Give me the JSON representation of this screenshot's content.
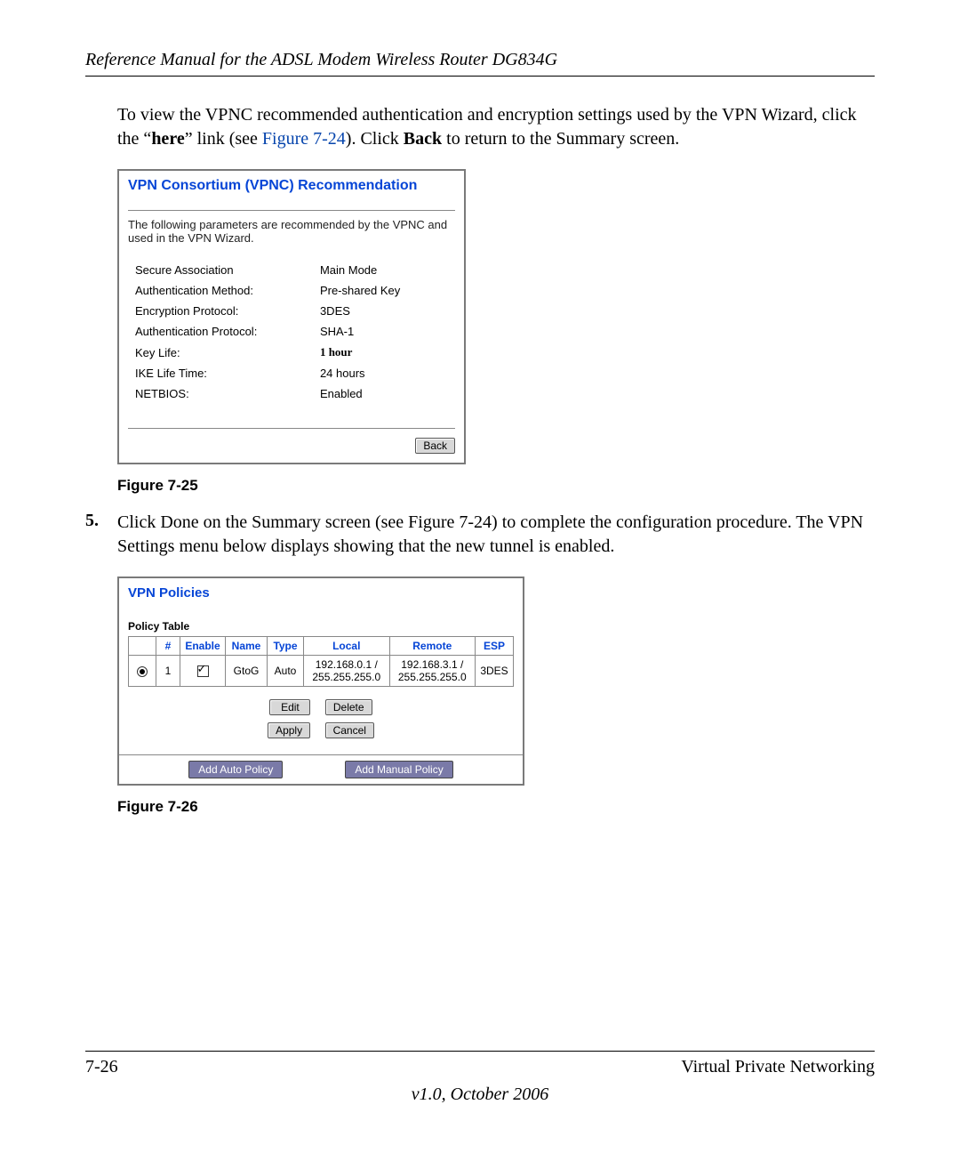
{
  "header": {
    "title": "Reference Manual for the ADSL Modem Wireless Router DG834G"
  },
  "intro": {
    "pre": "To view the VPNC recommended authentication and encryption settings used by the VPN Wizard, click the “",
    "here": "here",
    "mid": "” link (see ",
    "figref": "Figure 7-24",
    "post1": "). Click ",
    "back": "Back",
    "post2": " to return to the Summary screen."
  },
  "fig25": {
    "caption": "Figure 7-25",
    "title": "VPN Consortium (VPNC) Recommendation",
    "lead": "The following parameters are recommended by the VPNC and used in the VPN Wizard.",
    "rows": [
      {
        "label": "Secure Association",
        "value": "Main Mode"
      },
      {
        "label": "Authentication Method:",
        "value": "Pre-shared Key"
      },
      {
        "label": "Encryption Protocol:",
        "value": "3DES"
      },
      {
        "label": "Authentication Protocol:",
        "value": "SHA-1"
      },
      {
        "label": "Key Life:",
        "value": "1 hour",
        "bold": true
      },
      {
        "label": "IKE Life Time:",
        "value": "24 hours"
      },
      {
        "label": "NETBIOS:",
        "value": "Enabled"
      }
    ],
    "back_btn": "Back"
  },
  "step5": {
    "num": "5.",
    "pre": "Click ",
    "done": "Done",
    "mid": " on the Summary screen (see ",
    "figref": "Figure 7-24",
    "post": ") to complete the configuration procedure. The VPN Settings menu below displays showing that the new tunnel is enabled."
  },
  "fig26": {
    "caption": "Figure 7-26",
    "title": "VPN Policies",
    "subhead": "Policy Table",
    "headers": {
      "sel": "",
      "num": "#",
      "enable": "Enable",
      "name": "Name",
      "type": "Type",
      "local": "Local",
      "remote": "Remote",
      "esp": "ESP"
    },
    "row": {
      "num": "1",
      "name": "GtoG",
      "type": "Auto",
      "local": "192.168.0.1 / 255.255.255.0",
      "remote": "192.168.3.1 / 255.255.255.0",
      "esp": "3DES"
    },
    "buttons": {
      "edit": "Edit",
      "delete": "Delete",
      "apply": "Apply",
      "cancel": "Cancel",
      "add_auto": "Add Auto Policy",
      "add_manual": "Add Manual Policy"
    }
  },
  "footer": {
    "left": "7-26",
    "right": "Virtual Private Networking",
    "center": "v1.0, October 2006"
  }
}
